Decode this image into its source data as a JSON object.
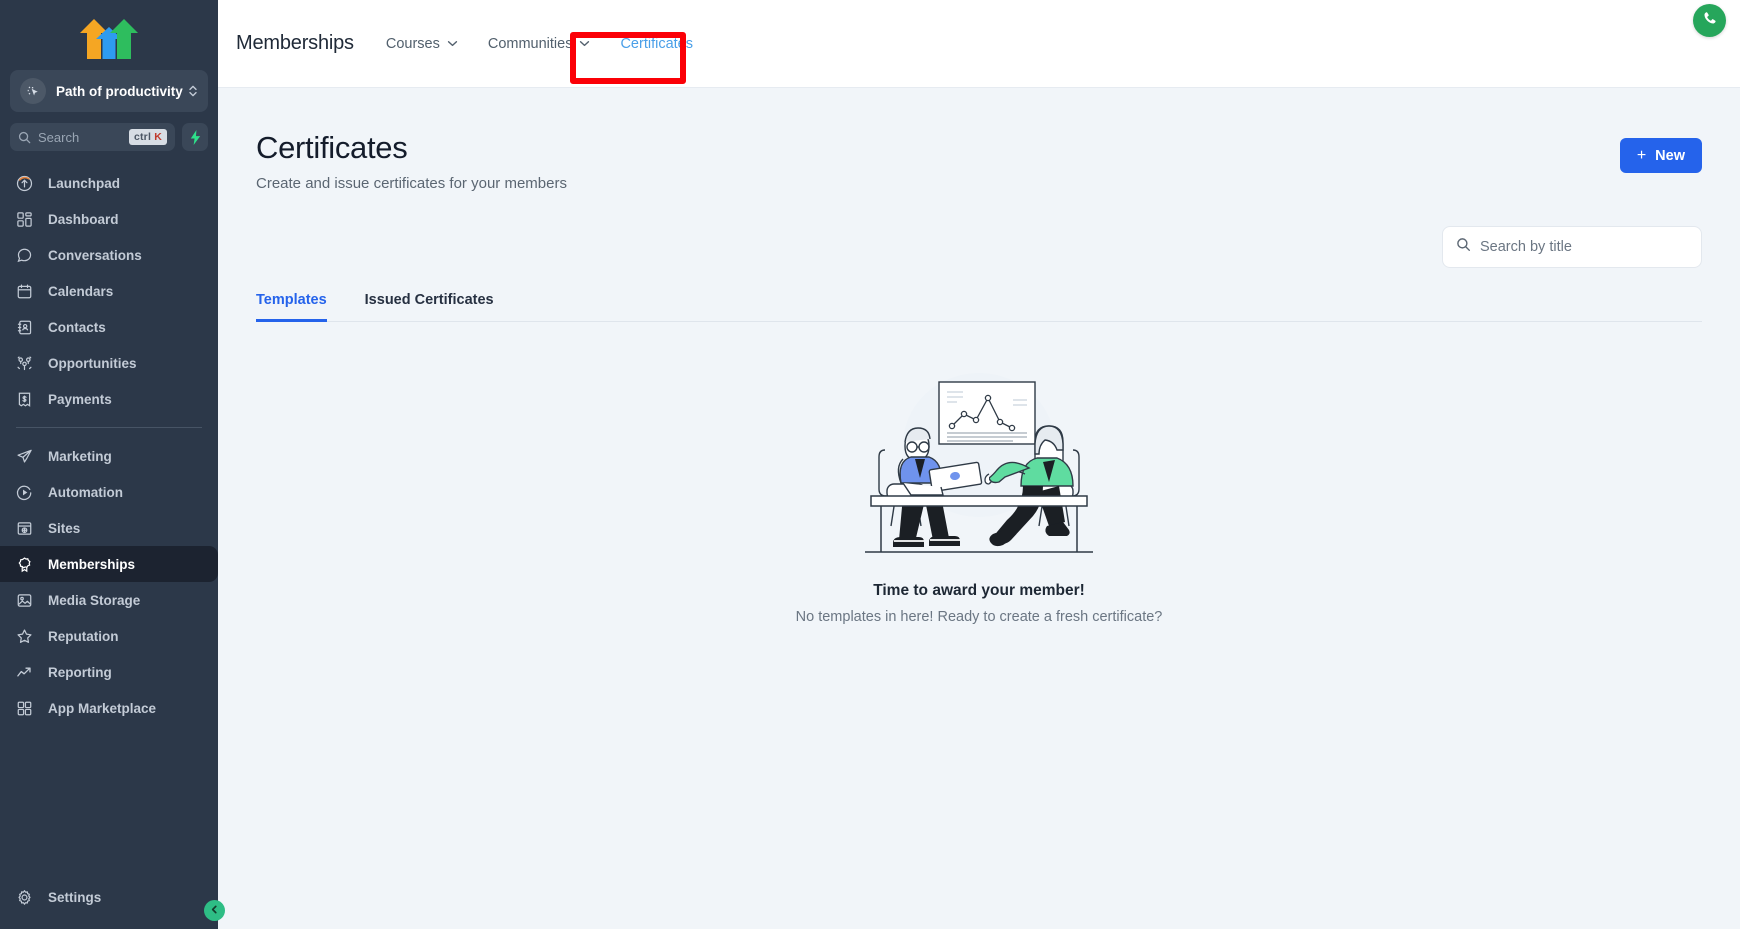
{
  "sidebar": {
    "logo_icon": "three-arrows-up-logo",
    "workspace": {
      "name": "Path of productivity",
      "avatar_icon": "cursor-click-icon",
      "chevron_icon": "chevron-up-down-icon"
    },
    "search": {
      "placeholder": "Search",
      "icon": "search-icon",
      "shortcut_prefix": "ctrl",
      "shortcut_key": "K",
      "spark_icon": "lightning-bolt-icon"
    },
    "items": [
      {
        "label": "Launchpad",
        "icon": "rocket-launchpad-icon",
        "active": false
      },
      {
        "label": "Dashboard",
        "icon": "dashboard-grid-icon",
        "active": false
      },
      {
        "label": "Conversations",
        "icon": "chat-bubble-icon",
        "active": false
      },
      {
        "label": "Calendars",
        "icon": "calendar-icon",
        "active": false
      },
      {
        "label": "Contacts",
        "icon": "contacts-book-icon",
        "active": false
      },
      {
        "label": "Opportunities",
        "icon": "opportunities-icon",
        "active": false
      },
      {
        "label": "Payments",
        "icon": "payments-bill-icon",
        "active": false
      }
    ],
    "items2": [
      {
        "label": "Marketing",
        "icon": "paper-plane-icon",
        "active": false
      },
      {
        "label": "Automation",
        "icon": "play-circle-icon",
        "active": false
      },
      {
        "label": "Sites",
        "icon": "browser-window-icon",
        "active": false
      },
      {
        "label": "Memberships",
        "icon": "award-badge-icon",
        "active": true
      },
      {
        "label": "Media Storage",
        "icon": "image-icon",
        "active": false
      },
      {
        "label": "Reputation",
        "icon": "star-icon",
        "active": false
      },
      {
        "label": "Reporting",
        "icon": "trend-up-icon",
        "active": false
      },
      {
        "label": "App Marketplace",
        "icon": "apps-grid-icon",
        "active": false
      }
    ],
    "settings": {
      "label": "Settings",
      "icon": "gear-icon"
    },
    "collapse": {
      "icon": "chevron-left-icon"
    }
  },
  "topbar": {
    "title": "Memberships",
    "nav": [
      {
        "label": "Courses",
        "has_caret": true,
        "active": false
      },
      {
        "label": "Communities",
        "has_caret": true,
        "active": false
      },
      {
        "label": "Certificates",
        "has_caret": false,
        "active": true
      }
    ],
    "phone_icon": "phone-icon",
    "highlight_color": "#fb0007"
  },
  "page": {
    "title": "Certificates",
    "subtitle": "Create and issue certificates for your members",
    "new_button": {
      "label": "New",
      "icon": "plus-icon"
    },
    "search": {
      "placeholder": "Search by title",
      "value": "",
      "icon": "search-icon"
    },
    "tabs": [
      {
        "label": "Templates",
        "active": true
      },
      {
        "label": "Issued Certificates",
        "active": false
      }
    ],
    "empty_state": {
      "illustration": "two-people-presentation-chart-illustration",
      "title": "Time to award your member!",
      "subtitle": "No templates in here! Ready to create a fresh certificate?"
    }
  },
  "colors": {
    "sidebar_bg": "#2c3849",
    "sidebar_active_bg": "#1c2330",
    "main_bg": "#f1f5f9",
    "accent_blue": "#2563eb",
    "tab_link_blue": "#4a9fe8",
    "highlight_red": "#fb0007",
    "phone_green": "#26a65b"
  }
}
